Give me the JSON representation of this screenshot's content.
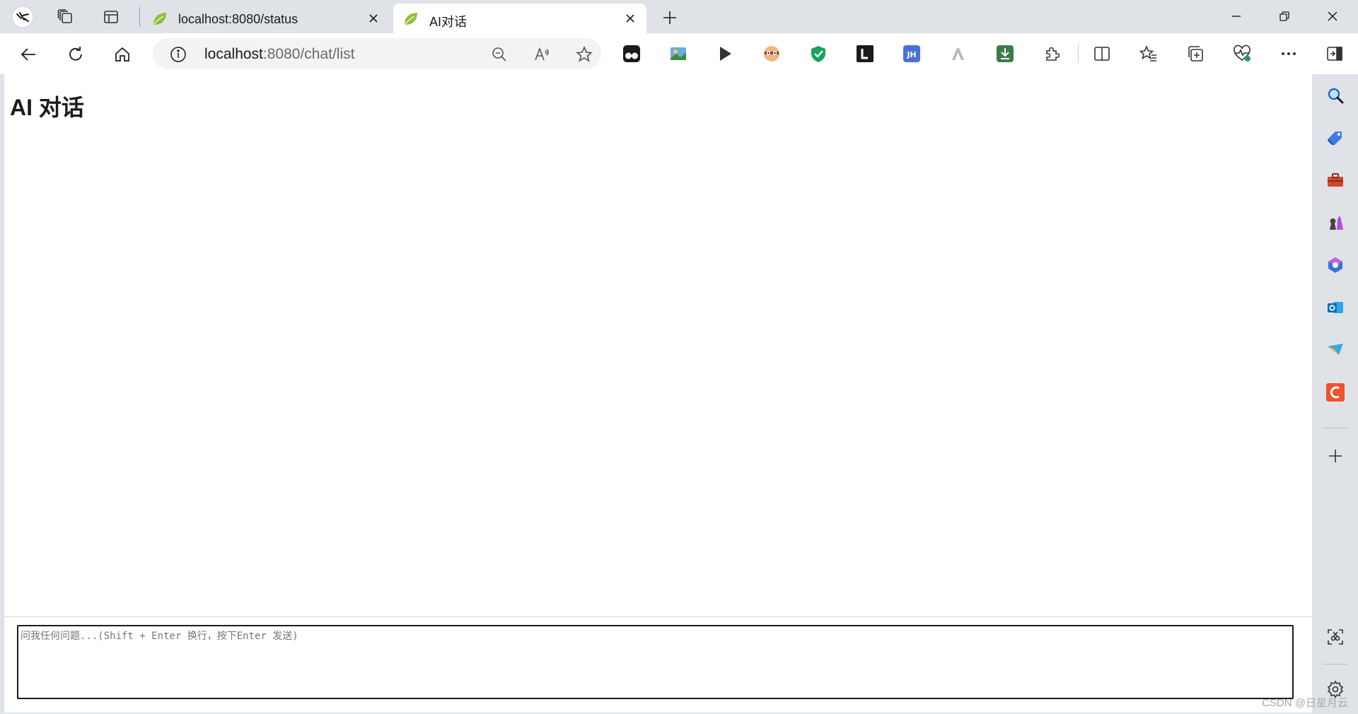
{
  "browser": {
    "tabs": [
      {
        "title": "localhost:8080/status",
        "active": false
      },
      {
        "title": "AI对话",
        "active": true
      }
    ],
    "address": {
      "host": "localhost",
      "rest": ":8080/chat/list"
    },
    "toolbar_icons": [
      "back-icon",
      "refresh-icon",
      "home-icon",
      "site-info-icon",
      "zoom-out-icon",
      "read-aloud-icon",
      "favorite-star-icon"
    ],
    "extensions": [
      "tampermonkey-extension",
      "image-extension",
      "play-extension",
      "face-mask-extension",
      "shield-extension",
      "l-extension",
      "jh-extension",
      "triangle-extension",
      "download-extension",
      "puzzle-extensions-icon",
      "split-screen-icon",
      "favorites-icon",
      "collections-icon",
      "performance-icon",
      "more-icon"
    ],
    "sidebar_icons": [
      "search-icon",
      "shopping-tag-icon",
      "toolbox-icon",
      "games-icon",
      "office-icon",
      "outlook-icon",
      "telegram-icon",
      "c-app-icon",
      "add-icon",
      "screenshot-icon",
      "settings-icon"
    ]
  },
  "page": {
    "heading": "AI 对话",
    "input": {
      "placeholder": "问我任何问题...(Shift + Enter 换行，按下Enter 发送)",
      "value": ""
    }
  },
  "watermark": "CSDN @日星月云",
  "colors": {
    "frame": "#dfe3e8",
    "page_bg": "#ffffff",
    "outlook_blue": "#0f6cbd",
    "shield_green": "#1aa260",
    "c_app_orange": "#f0522b",
    "jh_blue": "#4b6fd9"
  }
}
